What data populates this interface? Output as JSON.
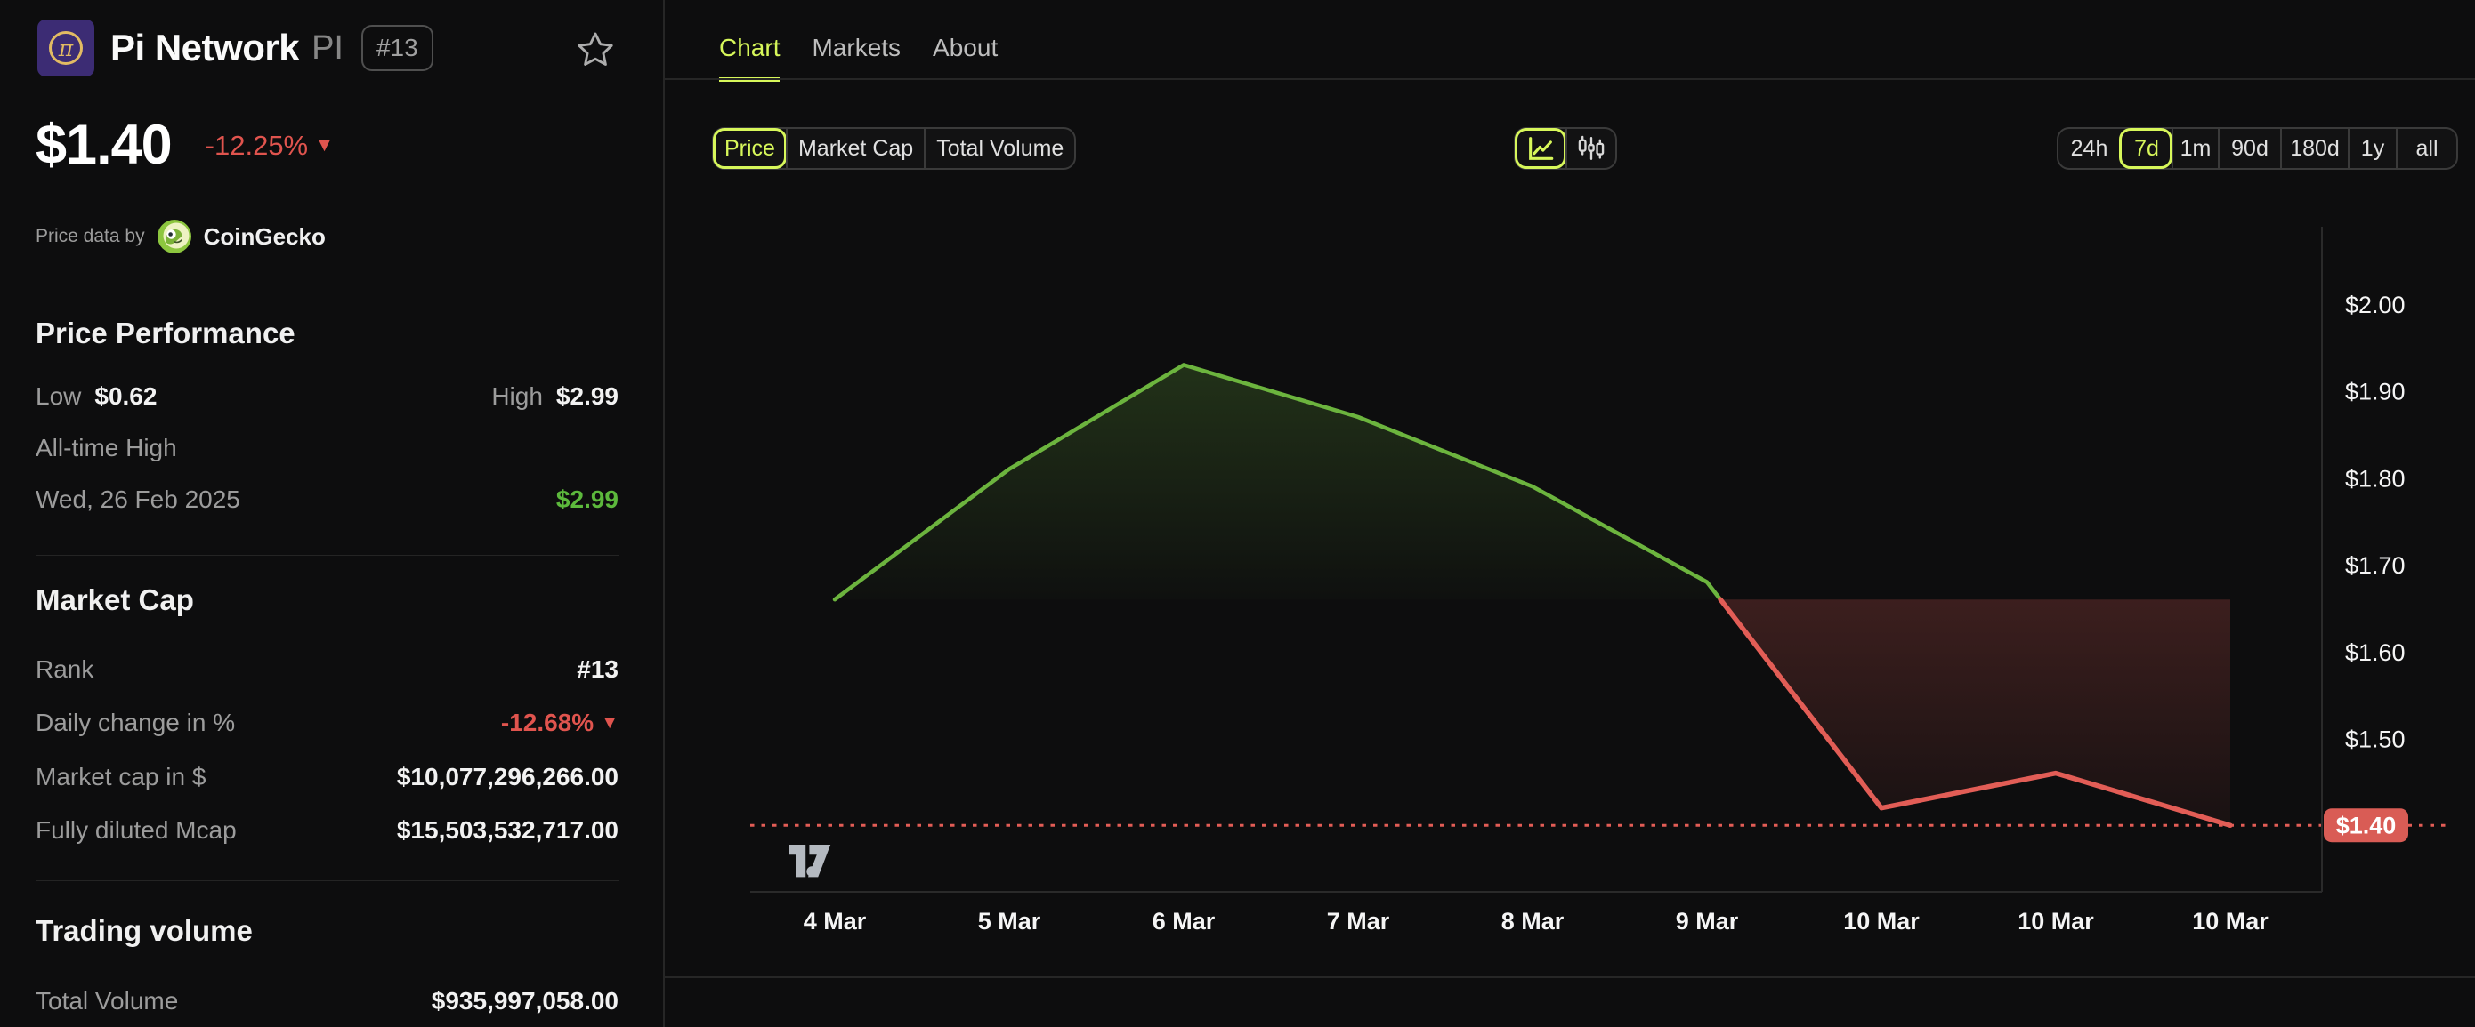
{
  "header": {
    "coin_name": "Pi Network",
    "ticker": "PI",
    "rank_badge": "#13",
    "price": "$1.40",
    "change": "-12.25%",
    "change_arrow": "▼",
    "attribution_prefix": "Price data by",
    "attribution_brand": "CoinGecko"
  },
  "sections": {
    "price_performance": {
      "title": "Price Performance",
      "low_label": "Low",
      "low_value": "$0.62",
      "high_label": "High",
      "high_value": "$2.99",
      "ath_label": "All-time High",
      "ath_date": "Wed, 26 Feb 2025",
      "ath_value": "$2.99"
    },
    "market_cap": {
      "title": "Market Cap",
      "rows": [
        {
          "label": "Rank",
          "value": "#13"
        },
        {
          "label": "Daily change in %",
          "value": "-12.68%",
          "arrow": "▼"
        },
        {
          "label": "Market cap in $",
          "value": "$10,077,296,266.00"
        },
        {
          "label": "Fully diluted Mcap",
          "value": "$15,503,532,717.00"
        }
      ]
    },
    "trading_volume": {
      "title": "Trading volume",
      "label": "Total Volume",
      "value": "$935,997,058.00"
    }
  },
  "tabs": [
    {
      "label": "Chart",
      "active": true
    },
    {
      "label": "Markets",
      "active": false
    },
    {
      "label": "About",
      "active": false
    }
  ],
  "controls": {
    "metrics": [
      {
        "label": "Price",
        "active": true
      },
      {
        "label": "Market Cap",
        "active": false
      },
      {
        "label": "Total Volume",
        "active": false
      }
    ],
    "chart_types": [
      "line-chart",
      "candlestick-chart"
    ],
    "ranges": [
      {
        "label": "24h",
        "active": false
      },
      {
        "label": "7d",
        "active": true
      },
      {
        "label": "1m",
        "active": false
      },
      {
        "label": "90d",
        "active": false
      },
      {
        "label": "180d",
        "active": false
      },
      {
        "label": "1y",
        "active": false
      },
      {
        "label": "all",
        "active": false
      }
    ]
  },
  "chart_data": {
    "type": "line",
    "title": "Pi Network price, 7 days",
    "categories": [
      "4 Mar",
      "5 Mar",
      "6 Mar",
      "7 Mar",
      "8 Mar",
      "9 Mar",
      "10 Mar",
      "10 Mar",
      "10 Mar"
    ],
    "values": [
      1.66,
      1.81,
      1.93,
      1.87,
      1.79,
      1.68,
      1.42,
      1.46,
      1.4
    ],
    "baseline_value": 1.66,
    "y_axis": {
      "labels": [
        "$2.00",
        "$1.90",
        "$1.80",
        "$1.70",
        "$1.60",
        "$1.50"
      ],
      "values": [
        2.0,
        1.9,
        1.8,
        1.7,
        1.6,
        1.5
      ]
    },
    "ylim": [
      1.33,
      2.09
    ],
    "grid": false,
    "legend": "none",
    "last_price": {
      "label": "$1.40",
      "value": 1.4
    },
    "colors": {
      "up": "#6cb43e",
      "down": "#e25d56",
      "badge": "#d95c55",
      "axis": "#2a2a2a",
      "tick_text": "#f5f5f5"
    }
  },
  "colors": {
    "accent": "#d7f75a",
    "negative": "#e0544e",
    "positive": "#5cb83c",
    "background": "#0d0d0e"
  }
}
